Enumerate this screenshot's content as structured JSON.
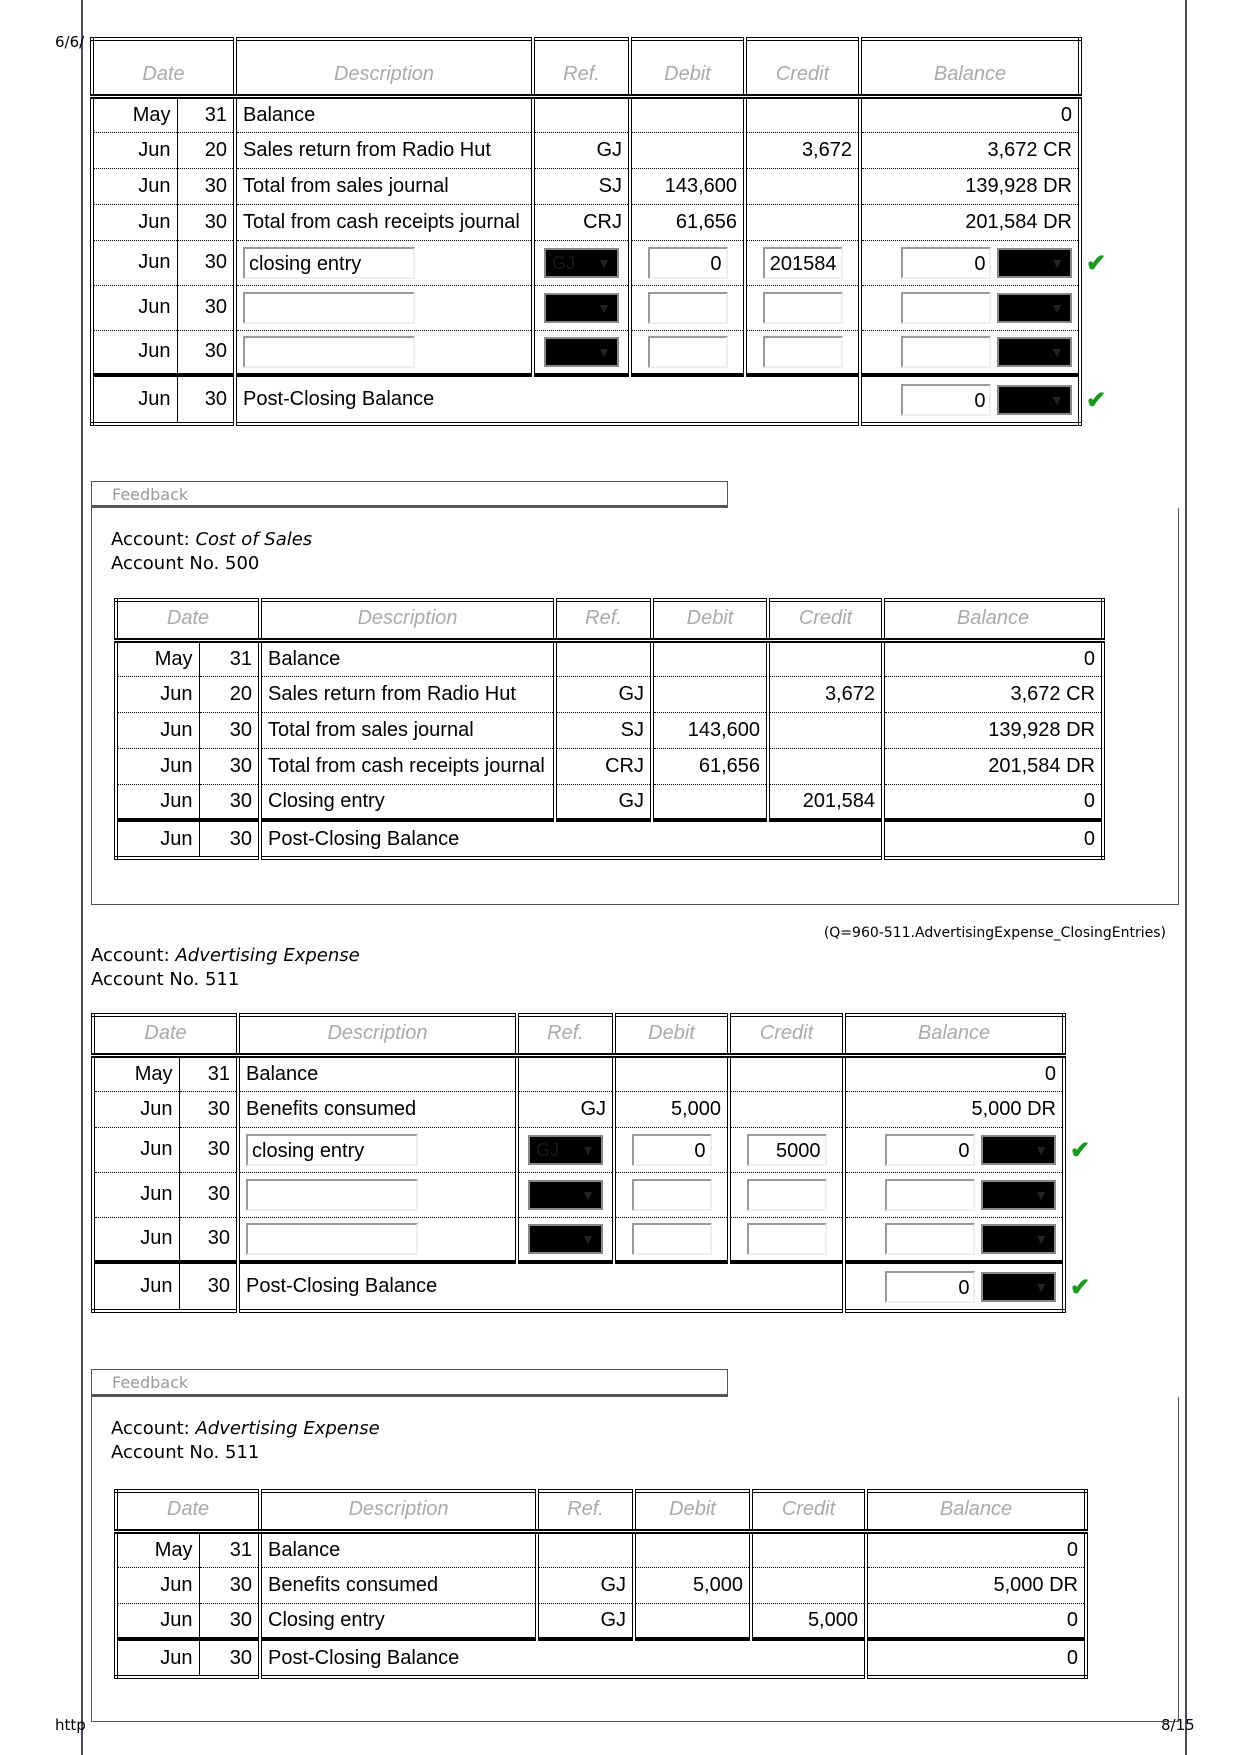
{
  "page": {
    "date_fragment": "6/6/",
    "url_fragment": "http",
    "page_number": "8/15",
    "question_id": "(Q=960-511.AdvertisingExpense_ClosingEntries)"
  },
  "headers": {
    "date": "Date",
    "description": "Description",
    "ref": "Ref.",
    "debit": "Debit",
    "credit": "Credit",
    "balance": "Balance"
  },
  "feedback_label": "Feedback",
  "colors": {
    "check": "#1a9a1a",
    "select_bg": "#000000",
    "header_text": "#aaaaaa"
  },
  "ledger1": {
    "rows": [
      {
        "type": "static",
        "month": "May",
        "day": "31",
        "desc": "Balance",
        "ref": "",
        "debit": "",
        "credit": "",
        "balance": "0"
      },
      {
        "type": "static",
        "month": "Jun",
        "day": "20",
        "desc": "Sales return from Radio Hut",
        "ref": "GJ",
        "debit": "",
        "credit": "3,672",
        "balance": "3,672 CR"
      },
      {
        "type": "static",
        "month": "Jun",
        "day": "30",
        "desc": "Total from sales journal",
        "ref": "SJ",
        "debit": "143,600",
        "credit": "",
        "balance": "139,928 DR"
      },
      {
        "type": "static",
        "month": "Jun",
        "day": "30",
        "desc": "Total from cash receipts journal",
        "ref": "CRJ",
        "debit": "61,656",
        "credit": "",
        "balance": "201,584 DR"
      },
      {
        "type": "input",
        "month": "Jun",
        "day": "30",
        "desc": "closing entry",
        "ref": "GJ",
        "debit": "0",
        "credit": "201584",
        "balance": "0",
        "balance_side": "",
        "check": true
      },
      {
        "type": "input",
        "month": "Jun",
        "day": "30",
        "desc": "",
        "ref": "",
        "debit": "",
        "credit": "",
        "balance": "",
        "balance_side": "",
        "check": false
      },
      {
        "type": "input",
        "month": "Jun",
        "day": "30",
        "desc": "",
        "ref": "",
        "debit": "",
        "credit": "",
        "balance": "",
        "balance_side": "",
        "check": false
      },
      {
        "type": "post-input",
        "month": "Jun",
        "day": "30",
        "desc": "Post-Closing Balance",
        "balance": "0",
        "balance_side": "",
        "check": true
      }
    ]
  },
  "feedback1": {
    "account_label": "Account: ",
    "account_name": "Cost of Sales",
    "account_no": "Account No. 500",
    "rows": [
      {
        "type": "static",
        "month": "May",
        "day": "31",
        "desc": "Balance",
        "ref": "",
        "debit": "",
        "credit": "",
        "balance": "0"
      },
      {
        "type": "static",
        "month": "Jun",
        "day": "20",
        "desc": "Sales return from Radio Hut",
        "ref": "GJ",
        "debit": "",
        "credit": "3,672",
        "balance": "3,672 CR"
      },
      {
        "type": "static",
        "month": "Jun",
        "day": "30",
        "desc": "Total from sales journal",
        "ref": "SJ",
        "debit": "143,600",
        "credit": "",
        "balance": "139,928 DR"
      },
      {
        "type": "static",
        "month": "Jun",
        "day": "30",
        "desc": "Total from cash receipts journal",
        "ref": "CRJ",
        "debit": "61,656",
        "credit": "",
        "balance": "201,584 DR"
      },
      {
        "type": "static",
        "month": "Jun",
        "day": "30",
        "desc": "Closing entry",
        "ref": "GJ",
        "debit": "",
        "credit": "201,584",
        "balance": "0"
      },
      {
        "type": "post",
        "month": "Jun",
        "day": "30",
        "desc": "Post-Closing Balance",
        "balance": "0"
      }
    ]
  },
  "account2": {
    "account_label": "Account: ",
    "account_name": "Advertising Expense",
    "account_no": "Account No. 511"
  },
  "ledger2": {
    "rows": [
      {
        "type": "static",
        "month": "May",
        "day": "31",
        "desc": "Balance",
        "ref": "",
        "debit": "",
        "credit": "",
        "balance": "0"
      },
      {
        "type": "static",
        "month": "Jun",
        "day": "30",
        "desc": "Benefits consumed",
        "ref": "GJ",
        "debit": "5,000",
        "credit": "",
        "balance": "5,000 DR"
      },
      {
        "type": "input",
        "month": "Jun",
        "day": "30",
        "desc": "closing entry",
        "ref": "GJ",
        "debit": "0",
        "credit": "5000",
        "balance": "0",
        "balance_side": "",
        "check": true
      },
      {
        "type": "input",
        "month": "Jun",
        "day": "30",
        "desc": "",
        "ref": "",
        "debit": "",
        "credit": "",
        "balance": "",
        "balance_side": "",
        "check": false
      },
      {
        "type": "input",
        "month": "Jun",
        "day": "30",
        "desc": "",
        "ref": "",
        "debit": "",
        "credit": "",
        "balance": "",
        "balance_side": "",
        "check": false
      },
      {
        "type": "post-input",
        "month": "Jun",
        "day": "30",
        "desc": "Post-Closing Balance",
        "balance": "0",
        "balance_side": "",
        "check": true
      }
    ]
  },
  "feedback2": {
    "account_label": "Account: ",
    "account_name": "Advertising Expense",
    "account_no": "Account No. 511",
    "rows": [
      {
        "type": "static",
        "month": "May",
        "day": "31",
        "desc": "Balance",
        "ref": "",
        "debit": "",
        "credit": "",
        "balance": "0"
      },
      {
        "type": "static",
        "month": "Jun",
        "day": "30",
        "desc": "Benefits consumed",
        "ref": "GJ",
        "debit": "5,000",
        "credit": "",
        "balance": "5,000 DR"
      },
      {
        "type": "static",
        "month": "Jun",
        "day": "30",
        "desc": "Closing entry",
        "ref": "GJ",
        "debit": "",
        "credit": "5,000",
        "balance": "0"
      },
      {
        "type": "post",
        "month": "Jun",
        "day": "30",
        "desc": "Post-Closing Balance",
        "balance": "0"
      }
    ]
  }
}
